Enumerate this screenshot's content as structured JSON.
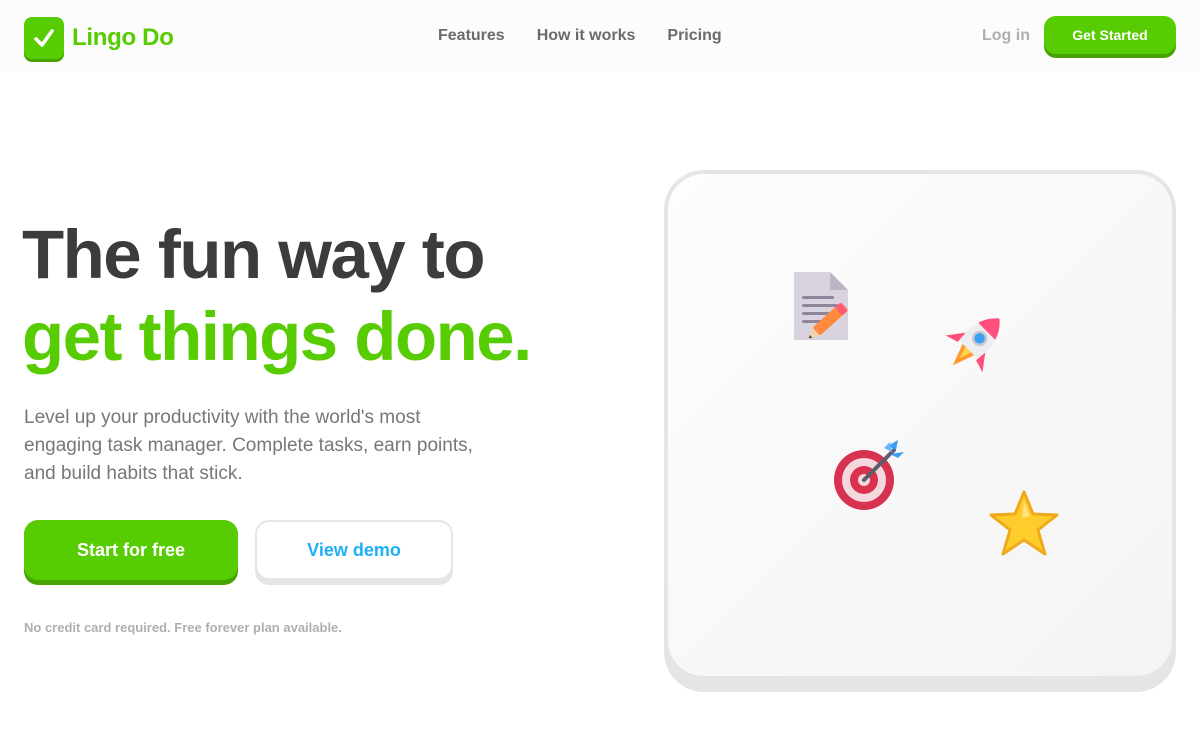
{
  "nav": {
    "brand": "Lingo Do",
    "links": [
      "Features",
      "How it works",
      "Pricing"
    ],
    "login": "Log in",
    "cta": "Get Started"
  },
  "hero": {
    "headline_line1": "The fun way to",
    "headline_line2": "get things done.",
    "subtext_lines": [
      "Level up your productivity with the world's most",
      "engaging task manager. Complete tasks, earn points,",
      "and build habits that stick."
    ],
    "primary_cta": "Start for free",
    "secondary_cta": "View demo",
    "note": "No credit card required. Free forever plan available."
  },
  "illustration": {
    "icons": [
      "memo-icon",
      "rocket-icon",
      "target-icon",
      "star-icon"
    ]
  },
  "colors": {
    "brand_green": "#58cc02",
    "brand_green_shadow": "#46a302",
    "link_blue": "#1cb0f6",
    "text_dark": "#3c3c3c",
    "text_muted": "#777777",
    "text_light": "#afafaf"
  }
}
